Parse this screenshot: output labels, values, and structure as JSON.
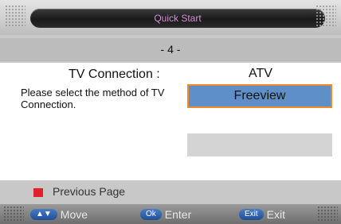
{
  "title": "Quick Start",
  "step": "- 4 -",
  "connection": {
    "heading": "TV Connection :",
    "description": "Please select the method of TV Connection."
  },
  "options": [
    {
      "label": "ATV",
      "selected": false
    },
    {
      "label": "Freeview",
      "selected": true
    },
    {
      "label": "",
      "selected": false
    }
  ],
  "previous_page": {
    "label": "Previous Page",
    "color": "#e0202a"
  },
  "hints": [
    {
      "key": "▲▼",
      "label": "Move"
    },
    {
      "key": "Ok",
      "label": "Enter"
    },
    {
      "key": "Exit",
      "label": "Exit"
    }
  ],
  "colors": {
    "selected_bg": "#5e8fc8",
    "selected_border": "#f08a24",
    "title_text": "#d890d8",
    "key_bg": "#2f5fa8"
  }
}
